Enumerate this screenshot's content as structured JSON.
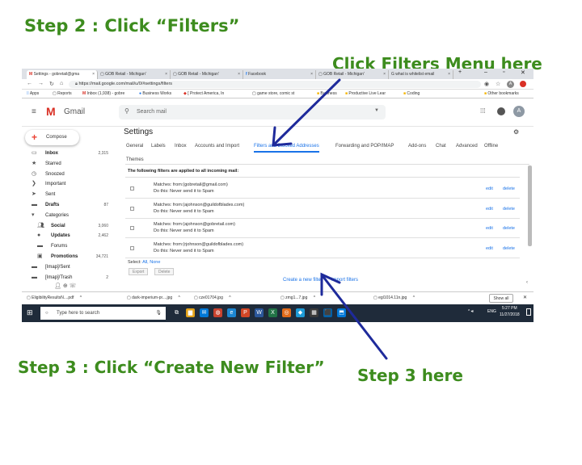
{
  "captions": {
    "step2": "Step 2 : Click “Filters”",
    "filters_here": "Click Filters Menu here",
    "step3": "Step 3 : Click “Create New Filter”",
    "step3_here": "Step 3 here"
  },
  "browser": {
    "tabs": [
      "Settings - gobretail@gma",
      "GOB Retail - Michigan'",
      "GOB Retail - Michigan'",
      "Facebook",
      "GOB Retail - Michigan'",
      "what is whitelist email"
    ],
    "url": "https://mail.google.com/mail/u/0/#settings/filters",
    "bookmarks": [
      "Apps",
      "Reports",
      "Inbox (1,938) - gobre",
      "Business Works",
      "[ Protect America, In",
      "game store, comic st",
      "Business",
      "Productive Live Lear",
      "Coding",
      "Other bookmarks"
    ]
  },
  "gmail": {
    "brand": "Gmail",
    "search_placeholder": "Search mail",
    "avatar": "A",
    "compose": "Compose",
    "nav": [
      {
        "label": "Inbox",
        "count": "2,315",
        "bold": true
      },
      {
        "label": "Starred",
        "count": ""
      },
      {
        "label": "Snoozed",
        "count": ""
      },
      {
        "label": "Important",
        "count": ""
      },
      {
        "label": "Sent",
        "count": ""
      },
      {
        "label": "Drafts",
        "count": "87",
        "bold": true
      },
      {
        "label": "Categories",
        "count": ""
      },
      {
        "label": "Social",
        "count": "3,060",
        "bold": true
      },
      {
        "label": "Updates",
        "count": "2,462",
        "bold": true
      },
      {
        "label": "Forums",
        "count": ""
      },
      {
        "label": "Promotions",
        "count": "34,721",
        "bold": true
      },
      {
        "label": "[Imap]/Sent",
        "count": ""
      },
      {
        "label": "[Imap]/Trash",
        "count": "2"
      }
    ]
  },
  "settings": {
    "title": "Settings",
    "tabs": [
      "General",
      "Labels",
      "Inbox",
      "Accounts and Import",
      "Filters and Blocked Addresses",
      "Forwarding and POP/IMAP",
      "Add-ons",
      "Chat",
      "Advanced",
      "Offline",
      "Themes"
    ],
    "applied_heading": "The following filters are applied to all incoming mail:",
    "filters": [
      {
        "matches": "Matches: from:(gobretail@gmail.com)",
        "action": "Do this: Never send it to Spam"
      },
      {
        "matches": "Matches: from:(ajohnson@guildofblades.com)",
        "action": "Do this: Never send it to Spam"
      },
      {
        "matches": "Matches: from:(ajohnson@gobretail.com)",
        "action": "Do this: Never send it to Spam"
      },
      {
        "matches": "Matches: from:(rjohnson@guildofblades.com)",
        "action": "Do this: Never send it to Spam"
      }
    ],
    "edit": "edit",
    "delete": "delete",
    "select": "Select:",
    "select_all": "All,",
    "select_none": "None",
    "export": "Export",
    "delete_btn": "Delete",
    "create_filter": "Create a new filter",
    "import_filters": "Import filters"
  },
  "downloads": {
    "items": [
      "EligibilityResultsN....pdf",
      "dark-imperium-pr....jpg",
      "cze01704.jpg",
      "zmg1...7.jpg",
      "egl1014.11n.jpg"
    ],
    "show_all": "Show all"
  },
  "taskbar": {
    "search": "Type here to search",
    "lang": "ENG",
    "time": "5:27 PM",
    "date": "11/27/2018"
  }
}
